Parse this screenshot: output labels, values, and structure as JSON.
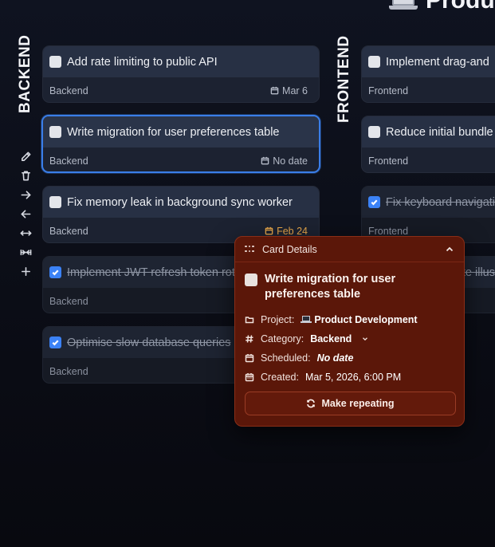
{
  "board": {
    "title": "Produ"
  },
  "columns": {
    "backend": {
      "label": "BACKEND"
    },
    "frontend": {
      "label": "FRONTEND"
    }
  },
  "toolbar": {
    "items": [
      {
        "icon": "pencil-icon"
      },
      {
        "icon": "trash-icon"
      },
      {
        "icon": "arrow-right-icon"
      },
      {
        "icon": "arrow-left-icon"
      },
      {
        "icon": "expand-horizontal-icon"
      },
      {
        "icon": "collapse-horizontal-icon"
      },
      {
        "icon": "plus-icon"
      }
    ]
  },
  "backend_cards": [
    {
      "title": "Add rate limiting to public API",
      "category": "Backend",
      "date": "Mar 6",
      "done": false
    },
    {
      "title": "Write migration for user preferences table",
      "category": "Backend",
      "date": "No date",
      "done": false,
      "selected": true
    },
    {
      "title": "Fix memory leak in background sync worker",
      "category": "Backend",
      "date": "Feb 24",
      "done": false,
      "due": true
    },
    {
      "title": "Implement JWT refresh token rotation",
      "category": "Backend",
      "date": "",
      "done": true
    },
    {
      "title": "Optimise slow database queries",
      "category": "Backend",
      "date": "",
      "done": true
    }
  ],
  "frontend_cards": [
    {
      "title": "Implement drag-and",
      "category": "Frontend",
      "done": false
    },
    {
      "title": "Reduce initial bundle",
      "category": "Frontend",
      "done": false
    },
    {
      "title": "Fix keyboard navigatio",
      "category": "Frontend",
      "done": true
    },
    {
      "title": "te illus",
      "category": "",
      "done": true
    }
  ],
  "details": {
    "header": "Card Details",
    "title": "Write migration for user preferences table",
    "project_label": "Project:",
    "project_value": "Product Development",
    "category_label": "Category:",
    "category_value": "Backend",
    "scheduled_label": "Scheduled:",
    "scheduled_value": "No date",
    "created_label": "Created:",
    "created_value": "Mar 5, 2026, 6:00 PM",
    "repeat_button": "Make repeating"
  },
  "colors": {
    "accent": "#3b82f6",
    "popup_bg": "#5b1709",
    "due": "#e6a64a"
  }
}
